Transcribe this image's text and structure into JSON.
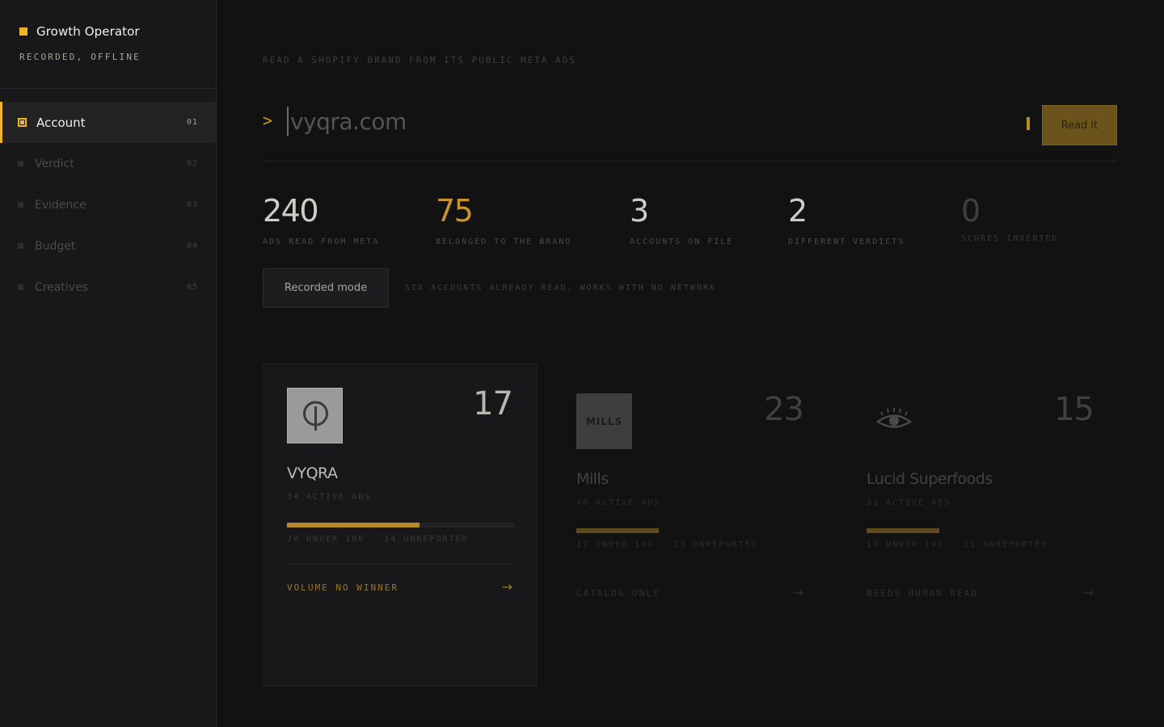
{
  "sidebar": {
    "brand": "Growth Operator",
    "status": "RECORDED, OFFLINE",
    "items": [
      {
        "label": "Account",
        "num": "01"
      },
      {
        "label": "Verdict",
        "num": "02"
      },
      {
        "label": "Evidence",
        "num": "03"
      },
      {
        "label": "Budget",
        "num": "04"
      },
      {
        "label": "Creatives",
        "num": "05"
      }
    ]
  },
  "main": {
    "eyebrow": "READ A SHOPIFY BRAND FROM ITS PUBLIC META ADS",
    "prompt": ">",
    "search": {
      "value": "vyqra.com",
      "placeholder": "vyqra.com"
    },
    "read_button": "Read it",
    "stats": [
      {
        "value": "240",
        "caption": "ADS READ FROM META"
      },
      {
        "value": "75",
        "caption": "BELONGED TO THE BRAND"
      },
      {
        "value": "3",
        "caption": "ACCOUNTS ON FILE"
      },
      {
        "value": "2",
        "caption": "DIFFERENT VERDICTS"
      },
      {
        "value": "0",
        "caption": "SCORES INVENTED"
      }
    ],
    "mode_button": "Recorded mode",
    "mode_note": "SIX ACCOUNTS ALREADY READ, WORKS WITH NO NETWORK"
  },
  "cards": [
    {
      "name": "VYQRA",
      "count": "17",
      "active": "34 ACTIVE ADS",
      "breakdown": "20 UNDER 100 · 14 UNREPORTED",
      "verdict": "VOLUME NO WINNER",
      "arrow": "→",
      "progress": 0.58
    },
    {
      "name": "Mills",
      "logo_text": "MILLS",
      "count": "23",
      "active": "40 ACTIVE ADS",
      "breakdown": "17 UNDER 100 · 23 UNREPORTED",
      "verdict": "CATALOG ONLY",
      "arrow": "→",
      "progress": 0.36
    },
    {
      "name": "Lucid Superfoods",
      "count": "15",
      "active": "31 ACTIVE ADS",
      "breakdown": "10 UNDER 100 · 21 UNREPORTED",
      "verdict": "NEEDS HUMAN READ",
      "arrow": "→",
      "progress": 0.32
    }
  ],
  "colors": {
    "accent": "#f0b429",
    "background": "#121213",
    "sidebar": "#18181a"
  }
}
